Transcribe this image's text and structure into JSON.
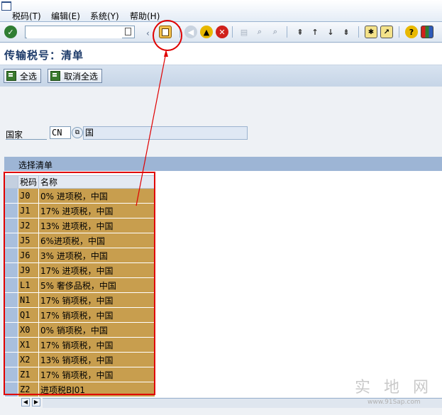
{
  "menu": {
    "items": [
      "税码(T)",
      "编辑(E)",
      "系统(Y)",
      "帮助(H)"
    ]
  },
  "toolbar": {
    "command_value": "",
    "icons": [
      "enter-icon",
      "save-icon",
      "back-icon",
      "exit-icon",
      "cancel-icon",
      "print-icon",
      "find-icon",
      "find-next-icon",
      "first-page-icon",
      "prev-page-icon",
      "next-page-icon",
      "last-page-icon",
      "create-session-icon",
      "shortcut-icon",
      "help-icon",
      "layout-icon"
    ]
  },
  "page": {
    "title": "传输税号：清单"
  },
  "app_toolbar": {
    "select_all": "全选",
    "deselect_all": "取消全选"
  },
  "country": {
    "label": "国家",
    "code": "CN",
    "name": "国"
  },
  "list": {
    "title": "选择清单",
    "columns": [
      "税码",
      "名称"
    ],
    "rows": [
      {
        "code": "J0",
        "name": "0% 进项税，中国"
      },
      {
        "code": "J1",
        "name": "17% 进项税，中国"
      },
      {
        "code": "J2",
        "name": "13% 进项税，中国"
      },
      {
        "code": "J5",
        "name": "6%进项税，中国"
      },
      {
        "code": "J6",
        "name": "3% 进项税，中国"
      },
      {
        "code": "J9",
        "name": "17% 进项税，中国"
      },
      {
        "code": "L1",
        "name": "5% 奢侈品税，中国"
      },
      {
        "code": "N1",
        "name": "17% 销项税，中国"
      },
      {
        "code": "Q1",
        "name": "17% 销项税，中国"
      },
      {
        "code": "X0",
        "name": "0% 销项税，中国"
      },
      {
        "code": "X1",
        "name": "17% 销项税，中国"
      },
      {
        "code": "X2",
        "name": "13% 销项税，中国"
      },
      {
        "code": "Z1",
        "name": "17% 销项税，中国"
      },
      {
        "code": "Z2",
        "name": "进项税BJ01"
      }
    ]
  },
  "watermark": {
    "text": "实 地 网",
    "url": "www.91Sap.com"
  },
  "colors": {
    "selected_row": "#c89e4e",
    "highlight": "#e00000",
    "header_bar": "#9db5d5"
  }
}
